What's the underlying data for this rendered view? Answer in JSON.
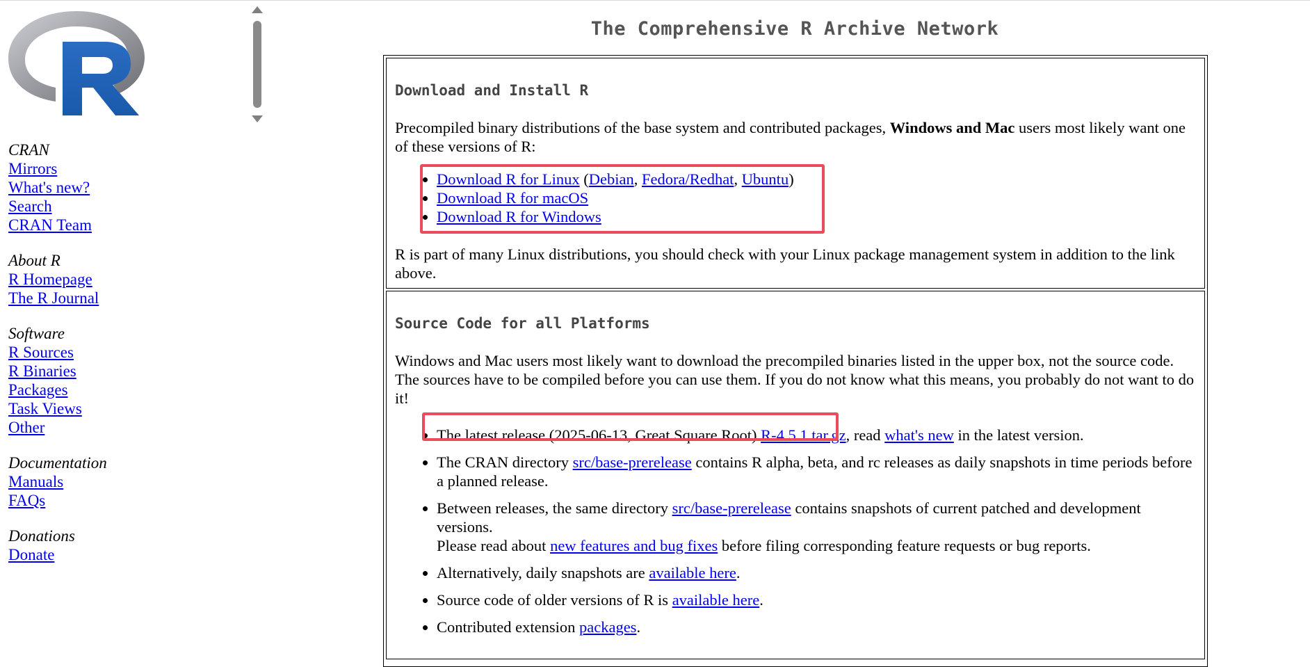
{
  "sidebar": {
    "sections": [
      {
        "title": "CRAN",
        "links": [
          "Mirrors",
          "What's new?",
          "Search",
          "CRAN Team"
        ]
      },
      {
        "title": "About R",
        "links": [
          "R Homepage",
          "The R Journal"
        ]
      },
      {
        "title": "Software",
        "links": [
          "R Sources",
          "R Binaries",
          "Packages",
          "Task Views",
          "Other"
        ]
      },
      {
        "title": "Documentation",
        "links": [
          "Manuals",
          "FAQs"
        ]
      },
      {
        "title": "Donations",
        "links": [
          "Donate"
        ]
      }
    ]
  },
  "main": {
    "title": "The Comprehensive R Archive Network",
    "download_box": {
      "heading": "Download and Install R",
      "intro_before": "Precompiled binary distributions of the base system and contributed packages, ",
      "intro_bold": "Windows and Mac",
      "intro_after": " users most likely want one of these versions of R:",
      "linux_link": "Download R for Linux",
      "linux_open": " (",
      "debian": "Debian",
      "comma1": ", ",
      "fedora": "Fedora/Redhat",
      "comma2": ", ",
      "ubuntu": "Ubuntu",
      "linux_close": ")",
      "macos_link": "Download R for macOS",
      "windows_link": "Download R for Windows",
      "note": "R is part of many Linux distributions, you should check with your Linux package management system in addition to the link above."
    },
    "source_box": {
      "heading": "Source Code for all Platforms",
      "intro": "Windows and Mac users most likely want to download the precompiled binaries listed in the upper box, not the source code. The sources have to be compiled before you can use them. If you do not know what this means, you probably do not want to do it!",
      "item1_before": "The latest release (2025-06-13, Great Square Root) ",
      "item1_link": "R-4.5.1.tar.gz",
      "item1_mid": ", read ",
      "item1_link2": "what's new",
      "item1_after": " in the latest version.",
      "item2_before": "The CRAN directory ",
      "item2_link": "src/base-prerelease",
      "item2_after": " contains R alpha, beta, and rc releases as daily snapshots in time periods before a planned release.",
      "item3_before": "Between releases, the same directory ",
      "item3_link": "src/base-prerelease",
      "item3_after": " contains snapshots of current patched and development versions.",
      "item3_line2_before": "Please read about ",
      "item3_line2_link": "new features and bug fixes",
      "item3_line2_after": " before filing corresponding feature requests or bug reports.",
      "item4_before": "Alternatively, daily snapshots are ",
      "item4_link": "available here",
      "item4_after": ".",
      "item5_before": "Source code of older versions of R is ",
      "item5_link": "available here",
      "item5_after": ".",
      "item6_before": "Contributed extension ",
      "item6_link": "packages",
      "item6_after": "."
    }
  },
  "colors": {
    "link": "#0000ee",
    "highlight": "#ea4c5c",
    "heading": "#555555"
  }
}
